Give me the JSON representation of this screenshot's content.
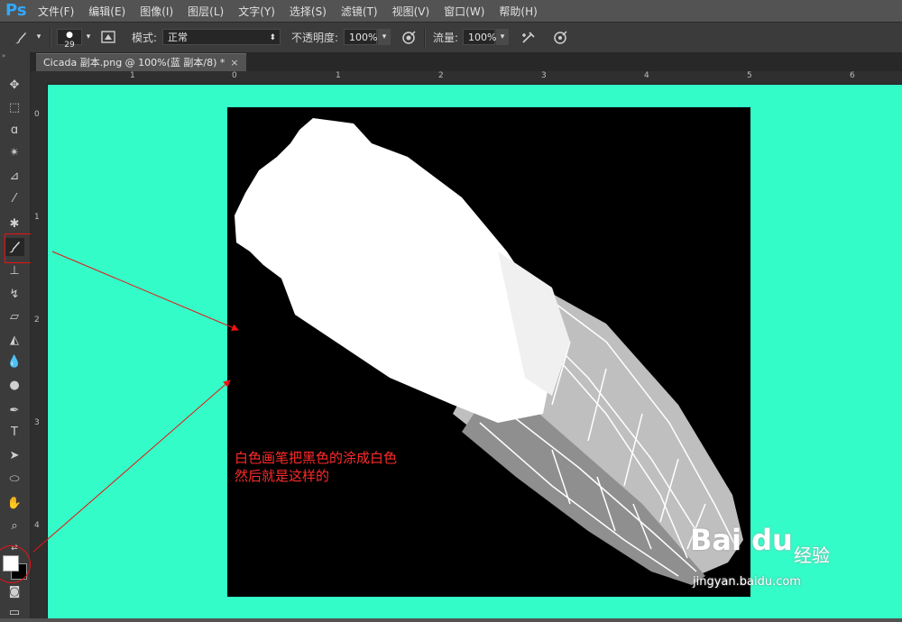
{
  "app": {
    "logo": "Ps"
  },
  "menu": [
    "文件(F)",
    "编辑(E)",
    "图像(I)",
    "图层(L)",
    "文字(Y)",
    "选择(S)",
    "滤镜(T)",
    "视图(V)",
    "窗口(W)",
    "帮助(H)"
  ],
  "options": {
    "brush_size": "29",
    "mode_label": "模式:",
    "mode_value": "正常",
    "opacity_label": "不透明度:",
    "opacity_value": "100%",
    "flow_label": "流量:",
    "flow_value": "100%"
  },
  "document": {
    "tab_title": "Cicada 副本.png @ 100%(蓝 副本/8) *",
    "close_glyph": "×"
  },
  "rulers": {
    "top": [
      "1",
      "0",
      "1",
      "2",
      "3",
      "4",
      "5",
      "6"
    ],
    "left": [
      "0",
      "1",
      "2",
      "3",
      "4"
    ]
  },
  "annotation": {
    "line1": "白色画笔把黑色的涂成白色",
    "line2": "然后就是这样的"
  },
  "watermark": {
    "logo": "Bai du",
    "jingyan": "经验",
    "url": "jingyan.baidu.com"
  },
  "colors": {
    "canvas_background": "#34fcc9",
    "foreground": "#ffffff",
    "background": "#000000",
    "annotation": "#ff2a2a"
  },
  "icons": {
    "toolbar": [
      "move-icon",
      "marquee-icon",
      "lasso-icon",
      "magic-wand-icon",
      "crop-icon",
      "eyedropper-icon",
      "healing-brush-icon",
      "brush-icon",
      "clone-stamp-icon",
      "history-brush-icon",
      "eraser-icon",
      "paint-bucket-icon",
      "blur-icon",
      "dodge-icon",
      "pen-icon",
      "type-icon",
      "path-selection-icon",
      "ellipse-icon",
      "hand-icon",
      "zoom-icon"
    ]
  }
}
